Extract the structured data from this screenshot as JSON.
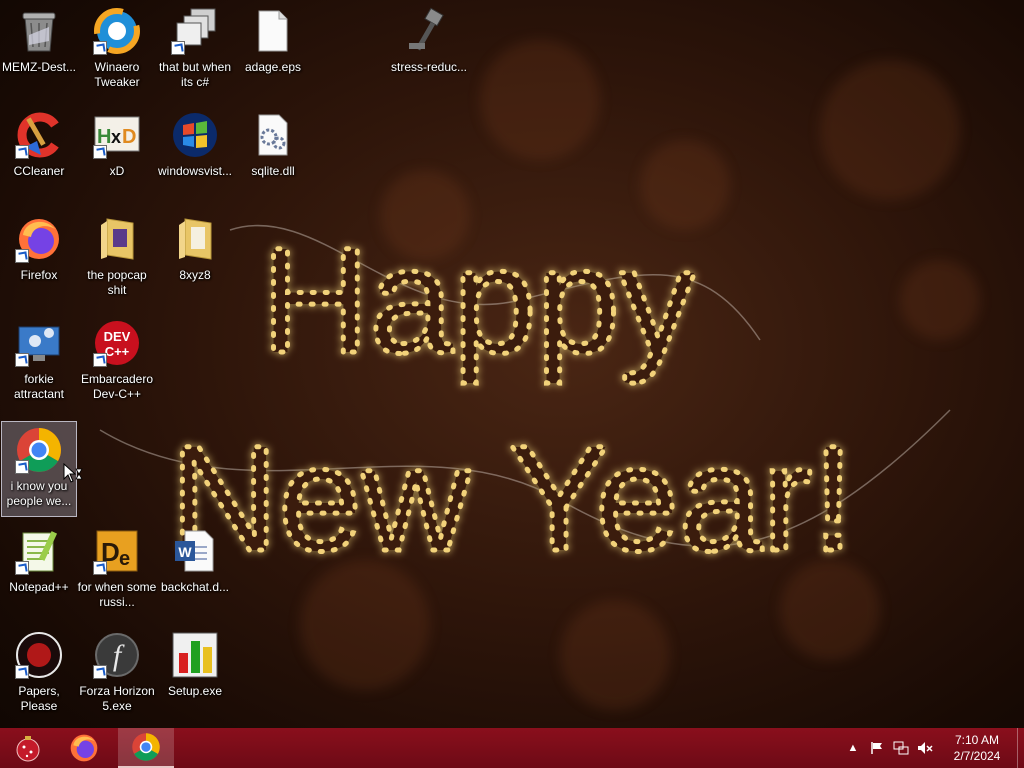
{
  "desktop": {
    "icons": [
      {
        "label": "MEMZ-Dest...",
        "icon": "recycle-bin-icon"
      },
      {
        "label": "Winaero Tweaker",
        "icon": "winaero-tweaker-icon"
      },
      {
        "label": "that but when its c#",
        "icon": "stacked-windows-icon"
      },
      {
        "label": "adage.eps",
        "icon": "blank-file-icon"
      },
      {
        "label": "stress-reduc...",
        "icon": "hammer-icon"
      },
      {
        "label": "CCleaner",
        "icon": "ccleaner-icon"
      },
      {
        "label": "xD",
        "icon": "hxd-icon"
      },
      {
        "label": "windowsvist...",
        "icon": "windows-vista-icon"
      },
      {
        "label": "sqlite.dll",
        "icon": "dll-file-icon"
      },
      {
        "label": "Firefox",
        "icon": "firefox-icon"
      },
      {
        "label": "the popcap shit",
        "icon": "folder-icon"
      },
      {
        "label": "8xyz8",
        "icon": "folder-icon"
      },
      {
        "label": "forkie attractant",
        "icon": "computer-settings-icon"
      },
      {
        "label": "Embarcadero Dev-C++",
        "icon": "devcpp-icon"
      },
      {
        "label": "i know you people we...",
        "icon": "chrome-icon"
      },
      {
        "label": "Notepad++",
        "icon": "notepadpp-icon"
      },
      {
        "label": "for when some russi...",
        "icon": "dexpot-icon"
      },
      {
        "label": "backchat.d...",
        "icon": "word-doc-icon"
      },
      {
        "label": "Papers, Please",
        "icon": "papers-please-icon"
      },
      {
        "label": "Forza Horizon 5.exe",
        "icon": "flash-icon"
      },
      {
        "label": "Setup.exe",
        "icon": "setup-chart-icon"
      }
    ]
  },
  "wallpaper": {
    "line1": "Happy",
    "line2": "New Year!"
  },
  "taskbar": {
    "start_icon": "christmas-ornament-icon",
    "pinned": [
      {
        "name": "Firefox",
        "icon": "firefox-icon",
        "active": false
      },
      {
        "name": "Google Chrome",
        "icon": "chrome-icon",
        "active": true
      }
    ],
    "tray": {
      "icons": [
        "chevron-up-icon",
        "flag-icon",
        "network-icon",
        "volume-muted-icon"
      ],
      "time": "7:10 AM",
      "date": "2/7/2024"
    }
  },
  "colors": {
    "taskbar": "#7a0d18",
    "accent": "#f2d27a"
  }
}
